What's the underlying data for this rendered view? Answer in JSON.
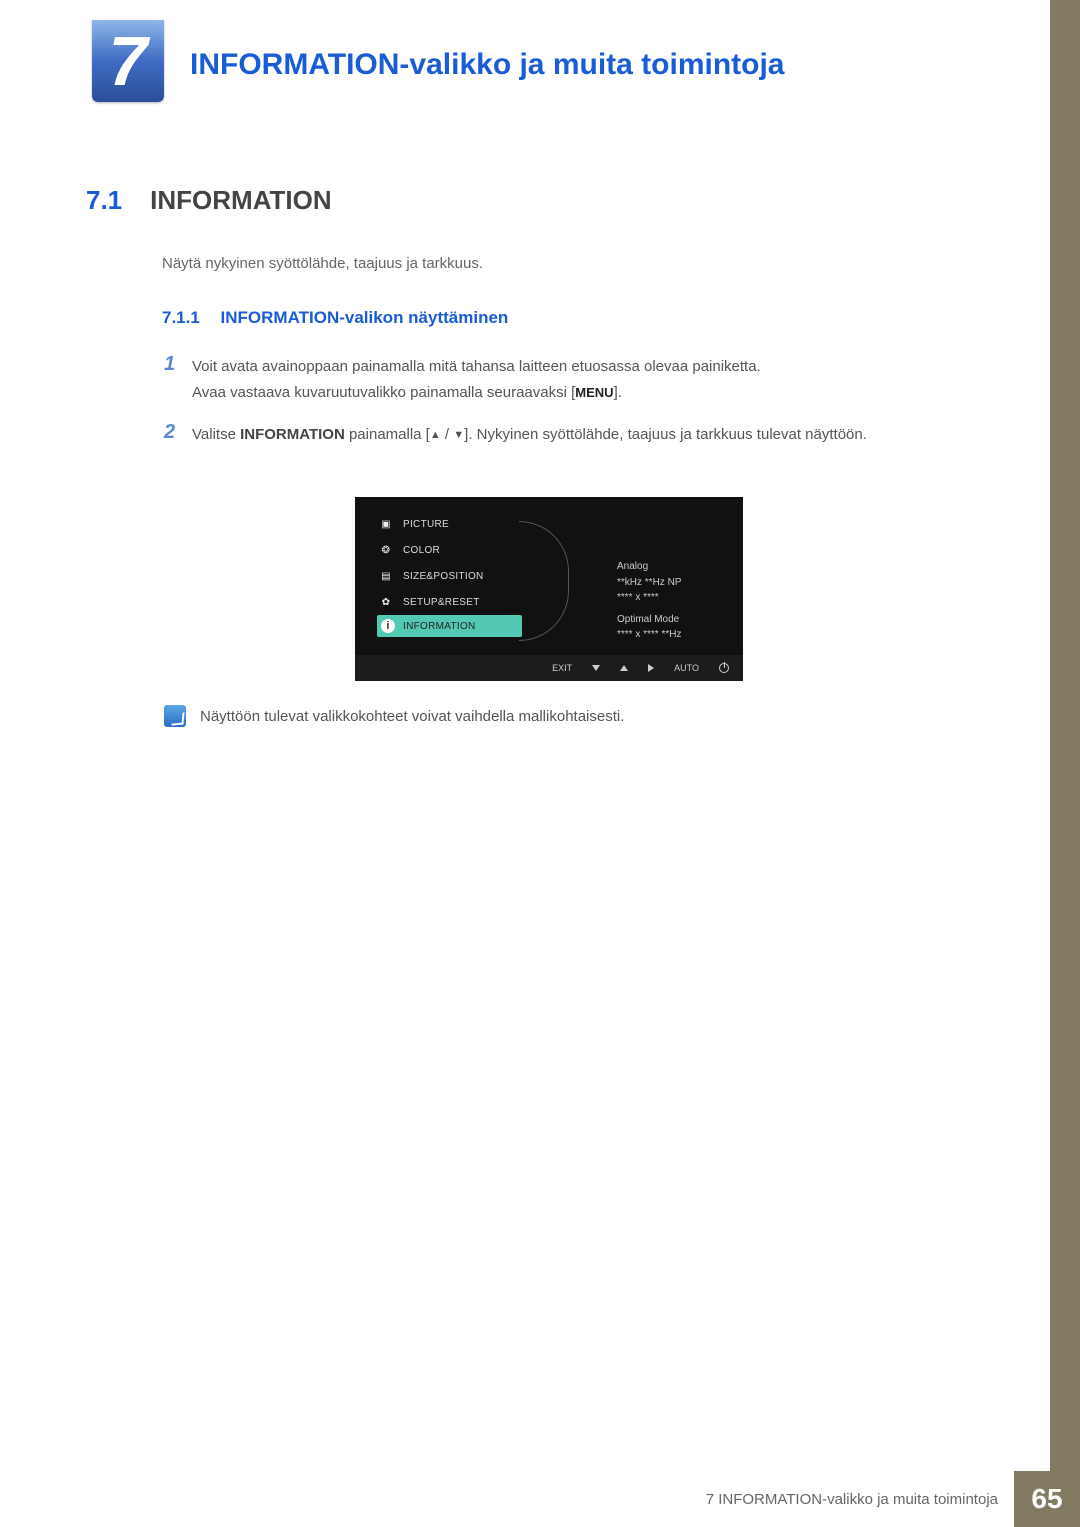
{
  "chapter": {
    "number": "7",
    "title": "INFORMATION-valikko ja muita toimintoja"
  },
  "section": {
    "number": "7.1",
    "title": "INFORMATION",
    "description": "Näytä nykyinen syöttölähde, taajuus ja tarkkuus."
  },
  "subsection": {
    "number": "7.1.1",
    "title": "INFORMATION-valikon näyttäminen"
  },
  "steps": {
    "1": {
      "num": "1",
      "line1": "Voit avata avainoppaan painamalla mitä tahansa laitteen etuosassa olevaa painiketta.",
      "line2a": "Avaa vastaava kuvaruutuvalikko painamalla seuraavaksi [",
      "menu_label": "MENU",
      "line2b": "]."
    },
    "2": {
      "num": "2",
      "pre": "Valitse ",
      "bold": "INFORMATION",
      "mid": " painamalla [",
      "tri_up": "▲",
      "slash": " / ",
      "tri_down": "▼",
      "after": "]. Nykyinen syöttölähde, taajuus ja tarkkuus tulevat näyttöön."
    }
  },
  "osd": {
    "menu": {
      "picture": "PICTURE",
      "color": "COLOR",
      "size_position": "SIZE&POSITION",
      "setup_reset": "SETUP&RESET",
      "information": "INFORMATION"
    },
    "info_panel": {
      "line1": "Analog",
      "line2": "**kHz **Hz NP",
      "line3": "**** x ****",
      "line4": "Optimal Mode",
      "line5": "**** x ****  **Hz"
    },
    "toolbar": {
      "exit": "EXIT",
      "auto": "AUTO"
    }
  },
  "note": "Näyttöön tulevat valikkokohteet voivat vaihdella mallikohtaisesti.",
  "footer": {
    "text": "7 INFORMATION-valikko ja muita toimintoja",
    "page": "65"
  }
}
